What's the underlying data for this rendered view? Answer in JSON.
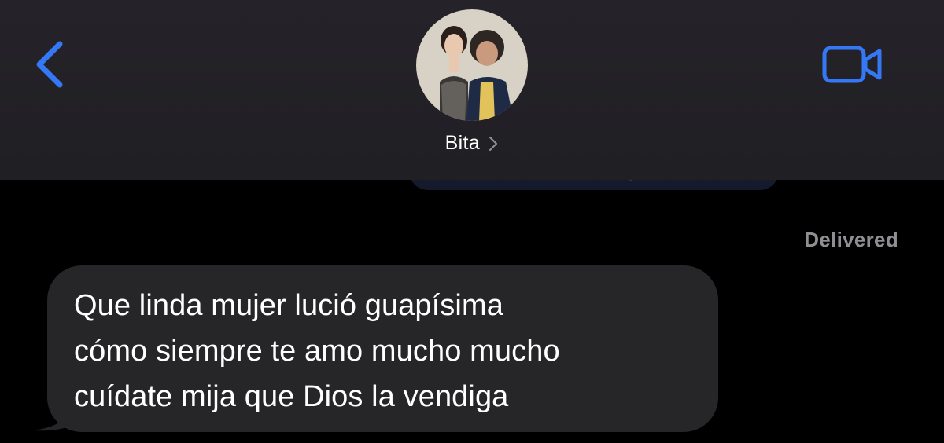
{
  "header": {
    "contact_name": "Bita",
    "back_icon": "chevron-left-icon",
    "video_icon": "video-camera-icon",
    "disclosure_icon": "chevron-right-icon",
    "accent_color": "#3478f6"
  },
  "thread": {
    "status": "Delivered",
    "message": {
      "lines": [
        "Que linda mujer lució guapísima",
        "cómo siempre te amo mucho mucho",
        "cuídate mija que Dios la vendiga"
      ]
    }
  }
}
